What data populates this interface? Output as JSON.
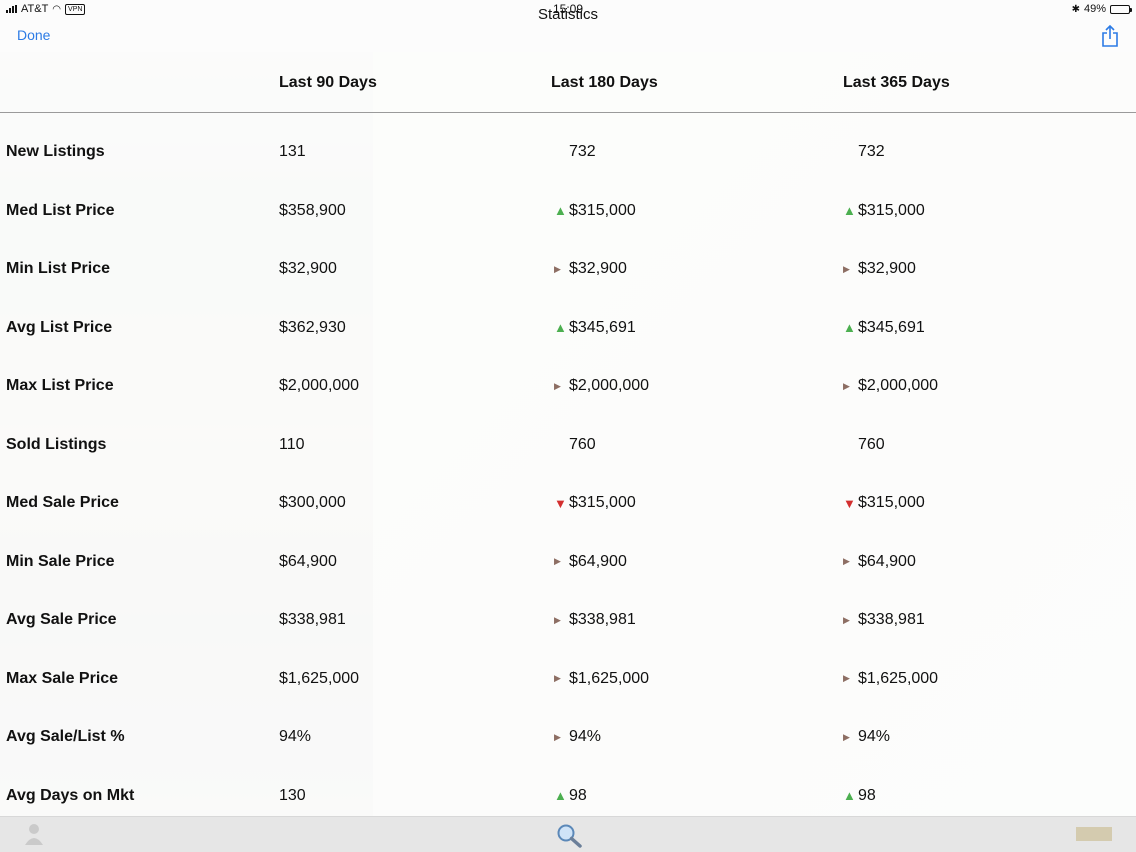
{
  "status_bar": {
    "carrier": "AT&T",
    "vpn": "VPN",
    "time": "15:09",
    "battery": "49%",
    "battery_level": 0.49
  },
  "nav": {
    "title": "Statistics",
    "done_label": "Done"
  },
  "table": {
    "headers": [
      "Last 90 Days",
      "Last 180 Days",
      "Last 365 Days"
    ],
    "rows": [
      {
        "label": "New Listings",
        "v90": "131",
        "v180": "732",
        "t180": "",
        "v365": "732",
        "t365": ""
      },
      {
        "label": "Med List Price",
        "v90": "$358,900",
        "v180": "$315,000",
        "t180": "up",
        "v365": "$315,000",
        "t365": "up"
      },
      {
        "label": "Min List Price",
        "v90": "$32,900",
        "v180": "$32,900",
        "t180": "flat",
        "v365": "$32,900",
        "t365": "flat"
      },
      {
        "label": "Avg List Price",
        "v90": "$362,930",
        "v180": "$345,691",
        "t180": "up",
        "v365": "$345,691",
        "t365": "up"
      },
      {
        "label": "Max List Price",
        "v90": "$2,000,000",
        "v180": "$2,000,000",
        "t180": "flat",
        "v365": "$2,000,000",
        "t365": "flat"
      },
      {
        "label": "Sold Listings",
        "v90": "110",
        "v180": "760",
        "t180": "",
        "v365": "760",
        "t365": ""
      },
      {
        "label": "Med Sale Price",
        "v90": "$300,000",
        "v180": "$315,000",
        "t180": "down",
        "v365": "$315,000",
        "t365": "down"
      },
      {
        "label": "Min Sale Price",
        "v90": "$64,900",
        "v180": "$64,900",
        "t180": "flat",
        "v365": "$64,900",
        "t365": "flat"
      },
      {
        "label": "Avg Sale Price",
        "v90": "$338,981",
        "v180": "$338,981",
        "t180": "flat",
        "v365": "$338,981",
        "t365": "flat"
      },
      {
        "label": "Max Sale Price",
        "v90": "$1,625,000",
        "v180": "$1,625,000",
        "t180": "flat",
        "v365": "$1,625,000",
        "t365": "flat"
      },
      {
        "label": "Avg Sale/List %",
        "v90": "94%",
        "v180": "94%",
        "t180": "flat",
        "v365": "94%",
        "t365": "flat"
      },
      {
        "label": "Avg Days on Mkt",
        "v90": "130",
        "v180": "98",
        "t180": "up",
        "v365": "98",
        "t365": "up"
      }
    ]
  },
  "icons": {
    "share": "share-icon",
    "search": "search-icon",
    "trend_up": "arrow-up-icon",
    "trend_down": "arrow-down-icon",
    "trend_flat": "arrow-right-icon"
  },
  "colors": {
    "accent": "#2c7be5",
    "trend_up": "#4caf50",
    "trend_down": "#d32f2f",
    "trend_flat": "#8d6e63"
  }
}
